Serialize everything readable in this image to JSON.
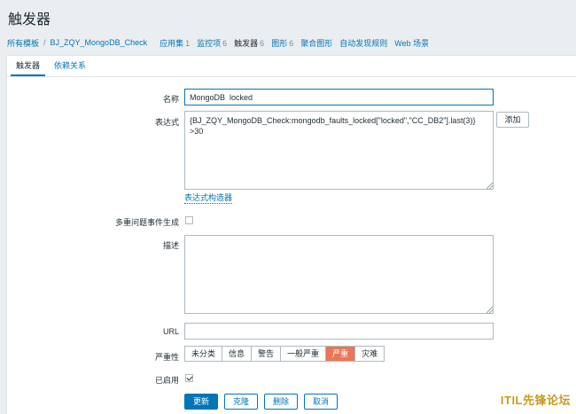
{
  "page_title": "触发器",
  "breadcrumb": {
    "all_templates": "所有模板",
    "separator": "/",
    "template_name": "BJ_ZQY_MongoDB_Check"
  },
  "nav": [
    {
      "label": "应用集",
      "count": "1"
    },
    {
      "label": "监控项",
      "count": "6"
    },
    {
      "label": "触发器",
      "count": "6"
    },
    {
      "label": "图形",
      "count": "6"
    },
    {
      "label": "聚合图形",
      "count": ""
    },
    {
      "label": "自动发现规则",
      "count": ""
    },
    {
      "label": "Web 场景",
      "count": ""
    }
  ],
  "tabs": [
    {
      "label": "触发器"
    },
    {
      "label": "依赖关系"
    }
  ],
  "form": {
    "name_label": "名称",
    "name_value": "MongoDB  locked",
    "expression_label": "表达式",
    "expression_value": "{BJ_ZQY_MongoDB_Check:mongodb_faults_locked[\"locked\",\"CC_DB2\"].last(3)}\n>30",
    "add_button": "添加",
    "expression_constructor": "表达式构造器",
    "multiple_events_label": "多重问题事件生成",
    "description_label": "描述",
    "description_value": "",
    "url_label": "URL",
    "url_value": "",
    "severity_label": "严重性",
    "severity_options": [
      "未分类",
      "信息",
      "警告",
      "一般严重",
      "严重",
      "灾难"
    ],
    "severity_selected": "严重",
    "enabled_label": "已启用"
  },
  "actions": {
    "update": "更新",
    "clone": "克隆",
    "delete": "删除",
    "cancel": "取消"
  },
  "watermark": "ITIL先锋论坛",
  "colors": {
    "accent": "#0275b8",
    "severity_high": "#e97659",
    "background": "#ebeef0"
  }
}
